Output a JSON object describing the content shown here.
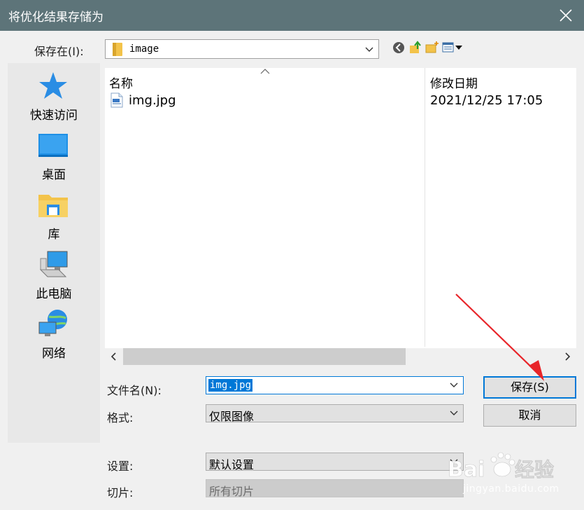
{
  "window": {
    "title": "将优化结果存储为"
  },
  "savein": {
    "label": "保存在(I):",
    "value": "image"
  },
  "places": [
    {
      "label": "快速访问",
      "icon": "star-icon"
    },
    {
      "label": "桌面",
      "icon": "desktop-icon"
    },
    {
      "label": "库",
      "icon": "library-folder-icon"
    },
    {
      "label": "此电脑",
      "icon": "computer-icon"
    },
    {
      "label": "网络",
      "icon": "network-icon"
    }
  ],
  "filelist": {
    "columns": [
      "名称",
      "修改日期"
    ],
    "rows": [
      {
        "name": "img.jpg",
        "modified": "2021/12/25 17:05"
      }
    ]
  },
  "filename": {
    "label": "文件名(N):",
    "value": "img.jpg"
  },
  "format": {
    "label": "格式:",
    "value": "仅限图像"
  },
  "settings": {
    "label": "设置:",
    "value": "默认设置"
  },
  "slices": {
    "label": "切片:",
    "value": "所有切片"
  },
  "buttons": {
    "save": "保存(S)",
    "cancel": "取消"
  },
  "watermark": {
    "text": "jingyan.baidu.com",
    "logo": "Baidu经验"
  },
  "colors": {
    "titlebar": "#5d7479",
    "accent": "#0078d7",
    "annotation_arrow": "#e8252a"
  }
}
